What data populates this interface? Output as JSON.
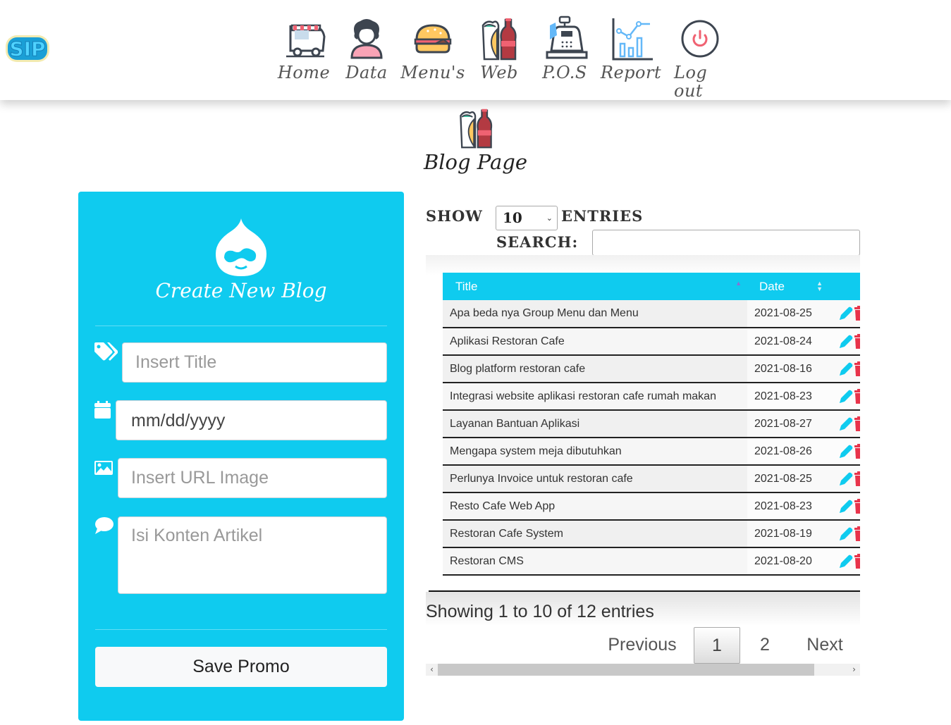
{
  "brand": {
    "logo_text": "SIP"
  },
  "nav": {
    "items": [
      {
        "label": "Home",
        "icon": "food-truck-icon"
      },
      {
        "label": "Data",
        "icon": "user-woman-icon"
      },
      {
        "label": "Menu's",
        "icon": "burger-icon"
      },
      {
        "label": "Web",
        "icon": "burrito-cola-icon"
      },
      {
        "label": "P.O.S",
        "icon": "cash-register-icon"
      },
      {
        "label": "Report",
        "icon": "bar-chart-icon"
      },
      {
        "label": "Log out",
        "icon": "power-icon"
      }
    ]
  },
  "page": {
    "title": "Blog Page",
    "icon": "burrito-cola-icon"
  },
  "form": {
    "title": "Create New Blog",
    "icon": "drupal-drop-icon",
    "title_placeholder": "Insert Title",
    "date_placeholder": "mm/dd/yyyy",
    "image_placeholder": "Insert URL Image",
    "content_placeholder": "Isi Konten Artikel",
    "save_label": "Save Promo",
    "accent": "#0fcbef"
  },
  "table": {
    "show_label": "SHOW",
    "entries_label": "ENTRIES",
    "length_value": "10",
    "search_label": "SEARCH:",
    "search_value": "",
    "columns": [
      "Title",
      "Date",
      ""
    ],
    "rows": [
      {
        "title": "Apa beda nya Group Menu dan Menu",
        "date": "2021-08-25"
      },
      {
        "title": "Aplikasi Restoran Cafe",
        "date": "2021-08-24"
      },
      {
        "title": "Blog platform restoran cafe",
        "date": "2021-08-16"
      },
      {
        "title": "Integrasi website aplikasi restoran cafe rumah makan",
        "date": "2021-08-23"
      },
      {
        "title": "Layanan Bantuan Aplikasi",
        "date": "2021-08-27"
      },
      {
        "title": "Mengapa system meja dibutuhkan",
        "date": "2021-08-26"
      },
      {
        "title": "Perlunya Invoice untuk restoran cafe",
        "date": "2021-08-25"
      },
      {
        "title": "Resto Cafe Web App",
        "date": "2021-08-23"
      },
      {
        "title": "Restoran Cafe System",
        "date": "2021-08-19"
      },
      {
        "title": "Restoran CMS",
        "date": "2021-08-20"
      }
    ],
    "edit_color": "#0fcbef",
    "delete_color": "#e8334a",
    "info": "Showing 1 to 10 of 12 entries",
    "pagination": {
      "previous": "Previous",
      "pages": [
        "1",
        "2"
      ],
      "current": "1",
      "next": "Next"
    }
  }
}
